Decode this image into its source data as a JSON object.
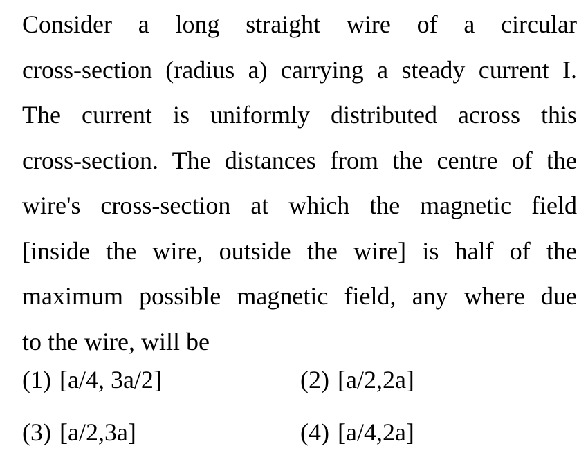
{
  "question": {
    "lines": [
      "Consider a long straight wire of a circular",
      "cross-section (radius a) carrying a steady current I.",
      "The current is uniformly distributed across this",
      "cross-section. The distances from the centre of the",
      "wire's cross-section at which the magnetic field",
      "[inside the wire, outside the wire] is half of the",
      "maximum possible magnetic field, any where due",
      "to the wire, will be"
    ]
  },
  "options": [
    {
      "number": "(1)",
      "text": "[a/4, 3a/2]"
    },
    {
      "number": "(2)",
      "text": "[a/2,2a]"
    },
    {
      "number": "(3)",
      "text": "[a/2,3a]"
    },
    {
      "number": "(4)",
      "text": "[a/4,2a]"
    }
  ]
}
